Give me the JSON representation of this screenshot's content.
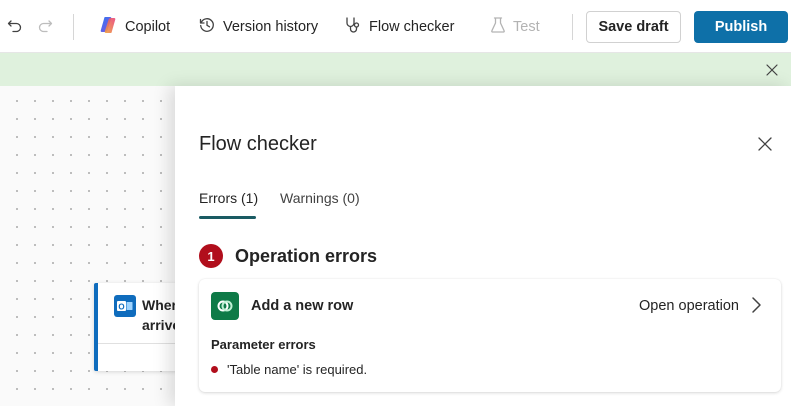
{
  "toolbar": {
    "undo_icon": "undo-icon",
    "redo_icon": "redo-icon",
    "copilot_label": "Copilot",
    "version_history_label": "Version history",
    "flow_checker_label": "Flow checker",
    "test_label": "Test",
    "save_draft_label": "Save draft",
    "publish_label": "Publish",
    "publish_color": "#0e70a8"
  },
  "banner": {
    "color": "#dff1dd",
    "close_icon": "close-icon"
  },
  "canvas": {
    "trigger_card": {
      "title": "Wher\narrive",
      "accent_color": "#0f6cbd"
    }
  },
  "panel": {
    "title": "Flow checker",
    "tabs": [
      {
        "label": "Errors (1)",
        "active": true
      },
      {
        "label": "Warnings (0)",
        "active": false
      }
    ],
    "section": {
      "count": "1",
      "title": "Operation errors"
    },
    "operation": {
      "name": "Add a new row",
      "open_label": "Open operation",
      "param_errors_title": "Parameter errors",
      "errors": [
        "'Table name' is required."
      ]
    },
    "error_color": "#b10e1c"
  }
}
